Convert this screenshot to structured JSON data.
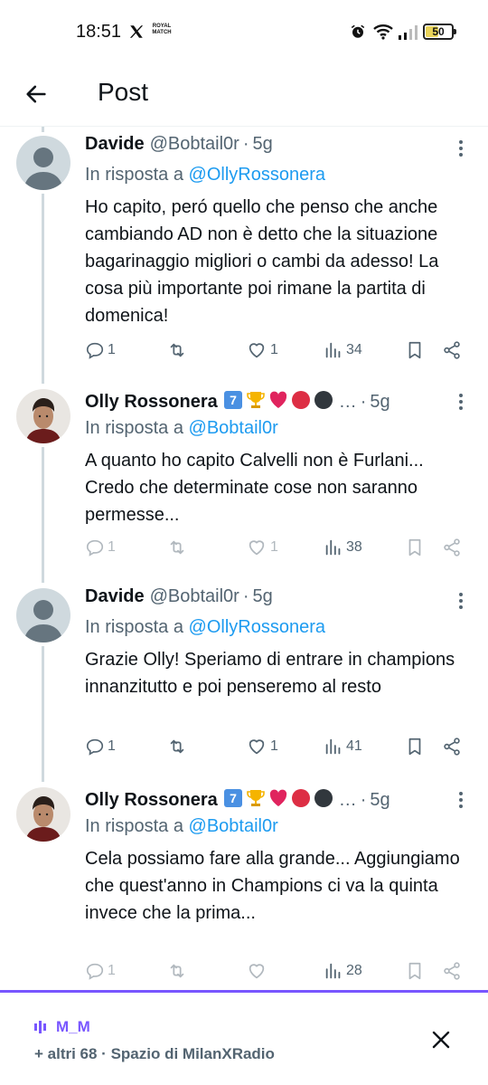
{
  "status_bar": {
    "time": "18:51",
    "battery": "50",
    "battery_level": 0.5,
    "royal_badge": "ROYAL MATCH"
  },
  "header": {
    "title": "Post"
  },
  "tweets": [
    {
      "name": "Davide",
      "handle": "@Bobtail0r",
      "time": "5g",
      "reply_label": "In risposta a",
      "reply_to": "@OllyRossonera",
      "text": "Ho capito, peró quello che penso che anche cambiando AD non è detto che la situazione bagarinaggio migliori o cambi da adesso! La cosa più importante poi rimane la partita di domenica!",
      "replies": "1",
      "likes": "1",
      "views": "34",
      "avatar": "default-avatar"
    },
    {
      "name": "Olly Rossonera",
      "handle": "…",
      "time": "5g",
      "reply_label": "In risposta a",
      "reply_to": "@Bobtail0r",
      "text": "A quanto ho capito Calvelli non è Furlani... Credo che determinate cose non saranno permesse...",
      "replies": "1",
      "likes": "1",
      "views": "38",
      "avatar": "photo-avatar",
      "emojis": [
        "keycap-7-icon",
        "trophy-icon",
        "red-heart-icon",
        "red-circle-icon",
        "black-circle-icon"
      ]
    },
    {
      "name": "Davide",
      "handle": "@Bobtail0r",
      "time": "5g",
      "reply_label": "In risposta a",
      "reply_to": "@OllyRossonera",
      "text": "Grazie Olly! Speriamo di entrare in champions innanzitutto e poi penseremo al resto",
      "replies": "1",
      "likes": "1",
      "views": "41",
      "avatar": "default-avatar"
    },
    {
      "name": "Olly Rossonera",
      "handle": "…",
      "time": "5g",
      "reply_label": "In risposta a",
      "reply_to": "@Bobtail0r",
      "text": "Cela possiamo fare alla grande... Aggiungiamo che quest'anno in Champions ci va la quinta invece che la prima...",
      "replies": "1",
      "likes": "",
      "views": "28",
      "avatar": "photo-avatar",
      "emojis": [
        "keycap-7-icon",
        "trophy-icon",
        "red-heart-icon",
        "red-circle-icon",
        "black-circle-icon"
      ]
    }
  ],
  "space_bar": {
    "host": "M_M",
    "subtitle": "+ altri 68 · Spazio di MilanXRadio",
    "accent": "#7856ff"
  },
  "colors": {
    "text": "#0f1419",
    "secondary": "#536471",
    "link": "#1d9bf0",
    "thread_line": "#cfd9de"
  }
}
